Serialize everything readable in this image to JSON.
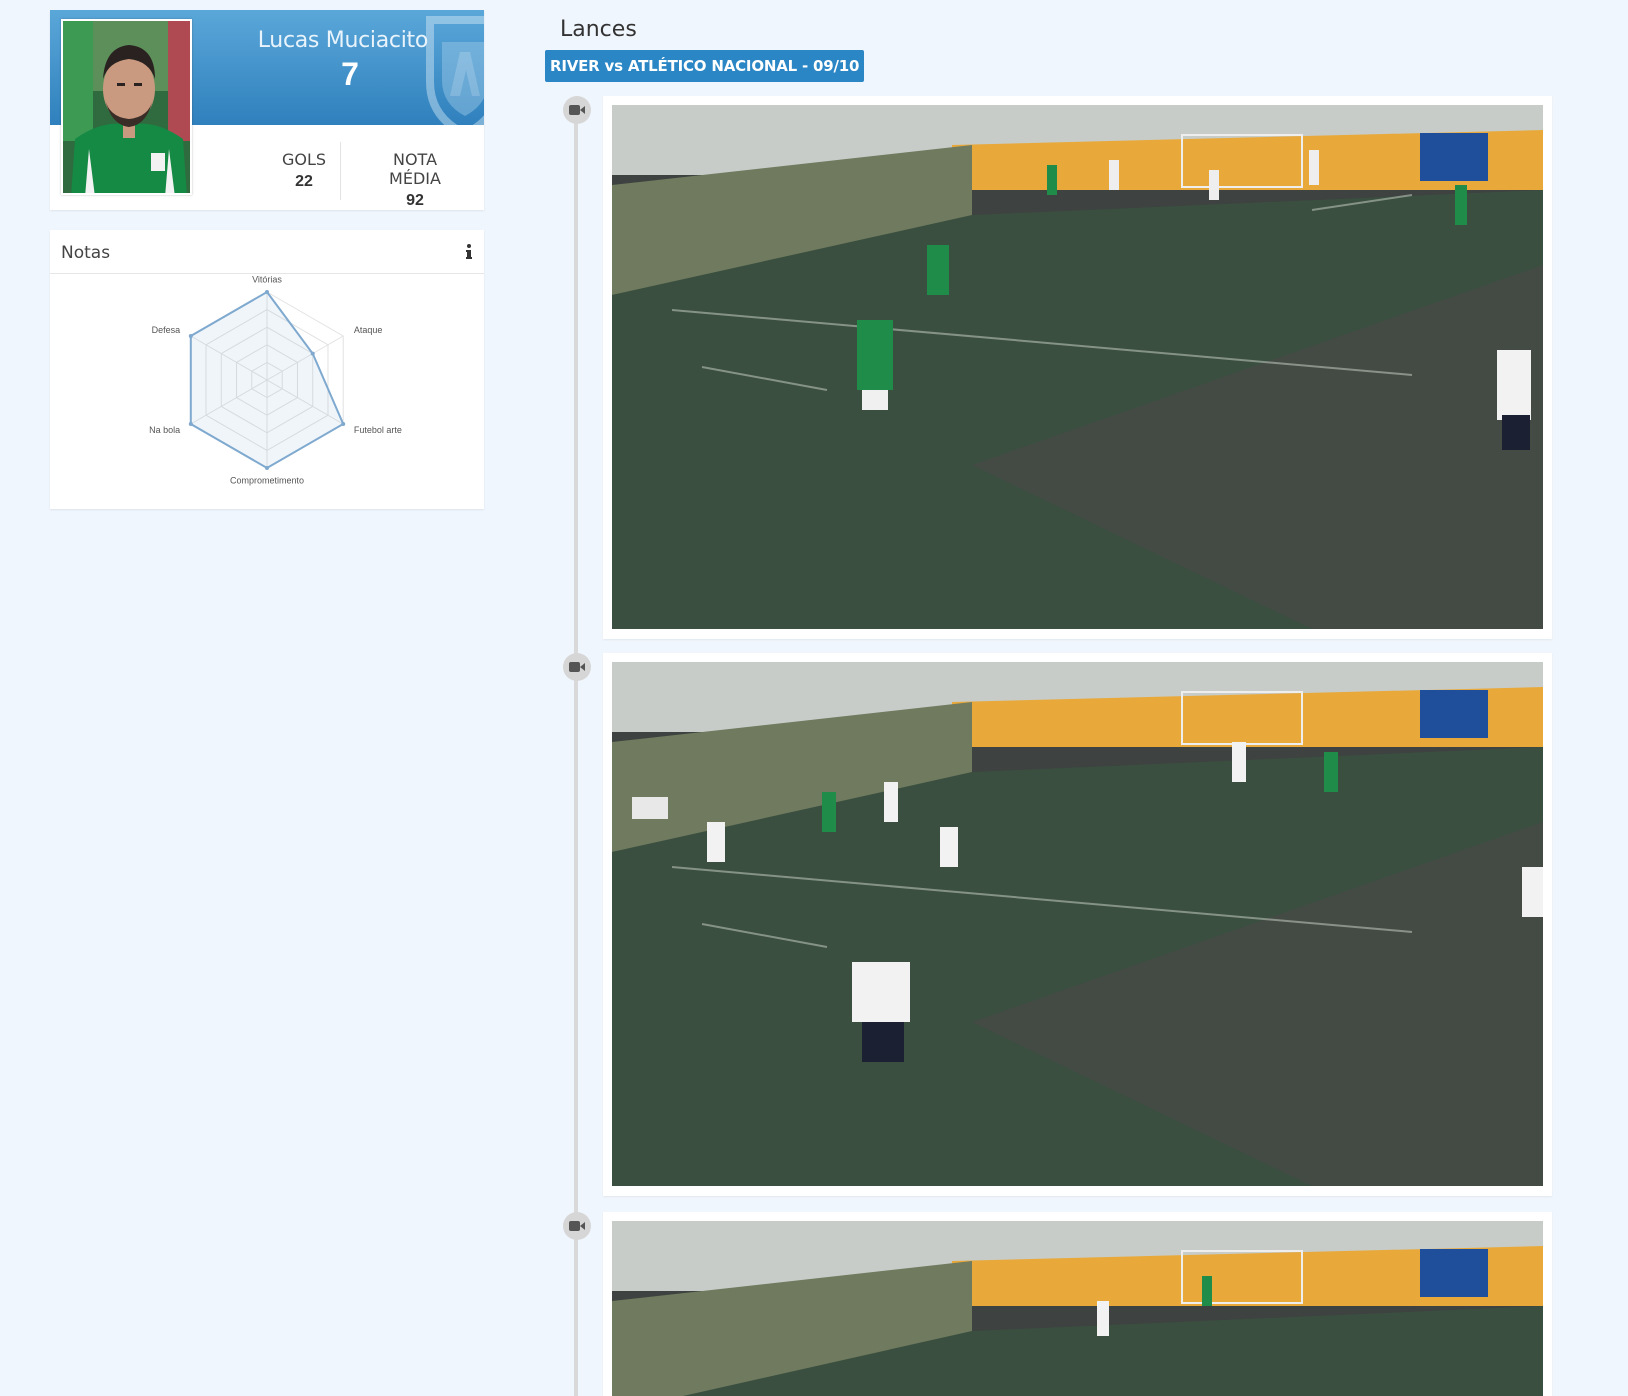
{
  "player": {
    "name": "Lucas Muciacito",
    "number": "7",
    "stats": {
      "gols_label": "GOLS",
      "gols_value": "22",
      "nota_label": "NOTA MÉDIA",
      "nota_value": "92"
    }
  },
  "notas": {
    "title": "Notas",
    "info_icon": "info-icon",
    "radar": {
      "axes": [
        "Vitórias",
        "Ataque",
        "Futebol arte",
        "Comprometimento",
        "Na bola",
        "Defesa"
      ],
      "values": [
        100,
        60,
        100,
        100,
        100,
        100
      ],
      "max": 100,
      "color": "#7fa9cf"
    }
  },
  "lances": {
    "title": "Lances",
    "match_label": "RIVER vs ATLÉTICO NACIONAL - 09/10",
    "items": [
      {
        "icon": "video-camera-icon"
      },
      {
        "icon": "video-camera-icon"
      },
      {
        "icon": "video-camera-icon"
      }
    ]
  },
  "colors": {
    "accent": "#2a86c4",
    "banner_top": "#5aa7d9",
    "banner_bottom": "#2f80bd",
    "background": "#f0f6fd"
  }
}
